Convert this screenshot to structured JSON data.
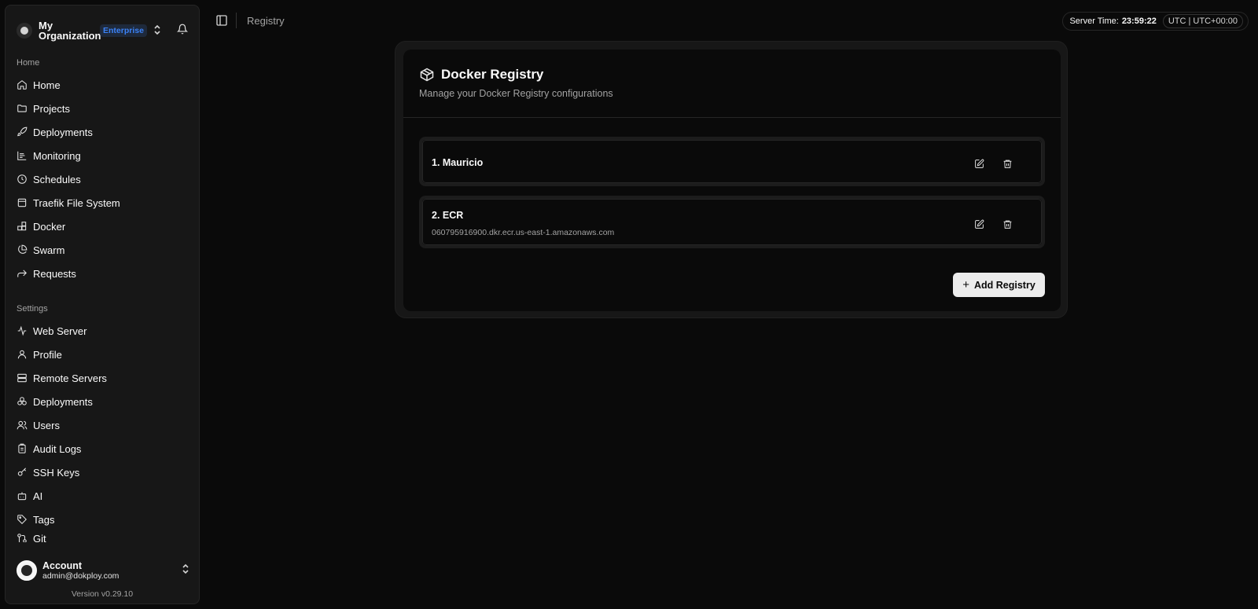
{
  "org": {
    "name": "My Organization",
    "badge": "Enterprise"
  },
  "nav": {
    "home_label": "Home",
    "home_items": [
      "Home",
      "Projects",
      "Deployments",
      "Monitoring",
      "Schedules",
      "Traefik File System",
      "Docker",
      "Swarm",
      "Requests"
    ],
    "settings_label": "Settings",
    "settings_items": [
      "Web Server",
      "Profile",
      "Remote Servers",
      "Deployments",
      "Users",
      "Audit Logs",
      "SSH Keys",
      "AI",
      "Tags",
      "Git"
    ]
  },
  "account": {
    "name": "Account",
    "email": "admin@dokploy.com"
  },
  "version": "Version v0.29.10",
  "breadcrumb": "Registry",
  "server_time": {
    "label": "Server Time:",
    "time": "23:59:22",
    "tz": "UTC | UTC+00:00"
  },
  "card": {
    "title": "Docker Registry",
    "subtitle": "Manage your Docker Registry configurations",
    "registries": [
      {
        "title": "1. Mauricio",
        "url": ""
      },
      {
        "title": "2. ECR",
        "url": "060795916900.dkr.ecr.us-east-1.amazonaws.com"
      }
    ],
    "add_label": "Add Registry"
  }
}
